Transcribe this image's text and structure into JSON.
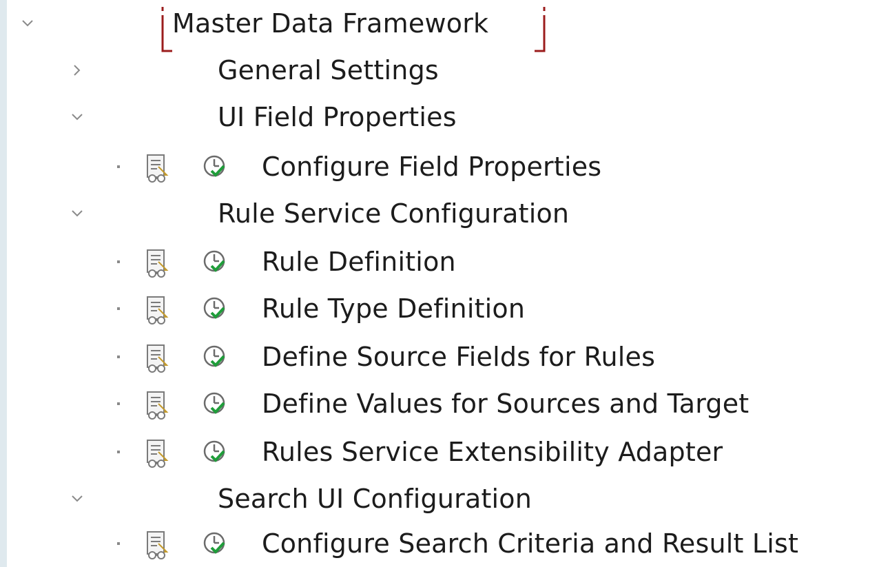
{
  "tree": {
    "root": {
      "label": "Master Data Framework",
      "state": "expanded",
      "focused": true
    },
    "general_settings": {
      "label": "General Settings",
      "state": "collapsed"
    },
    "ui_field_properties": {
      "label": "UI Field Properties",
      "state": "expanded",
      "children": [
        {
          "label": "Configure Field Properties"
        }
      ]
    },
    "rule_service_configuration": {
      "label": "Rule Service Configuration",
      "state": "expanded",
      "children": [
        {
          "label": "Rule Definition"
        },
        {
          "label": "Rule Type Definition"
        },
        {
          "label": "Define Source Fields for Rules"
        },
        {
          "label": "Define Values for Sources and Target"
        },
        {
          "label": "Rules Service Extensibility Adapter"
        }
      ]
    },
    "search_ui_configuration": {
      "label": "Search UI Configuration",
      "state": "expanded",
      "children": [
        {
          "label": "Configure Search Criteria and Result List"
        }
      ]
    }
  },
  "icons": {
    "expanded": "chevron-down-icon",
    "collapsed": "chevron-right-icon",
    "activity_doc": "activity-documentation-icon",
    "activity_exec": "execute-activity-icon"
  },
  "colors": {
    "focus_border": "#9b1c1c",
    "exec_check": "#1f9d3a",
    "exec_circle": "#6b6b6b",
    "text": "#1c1c1c",
    "left_strip": "#dfe9ee"
  }
}
